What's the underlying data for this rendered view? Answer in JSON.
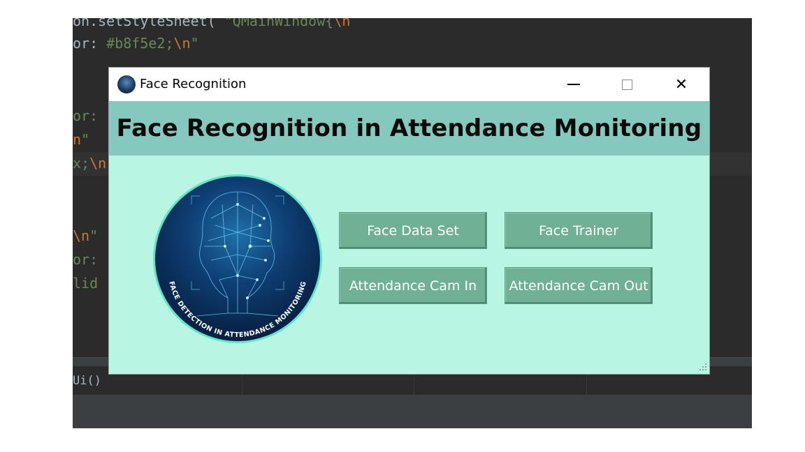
{
  "ide": {
    "code_lines": [
      {
        "a": "on.setStyleSheet(",
        "s": " \"QMainWindow{",
        "e": "\\n"
      },
      {
        "a": "or: ",
        "s": "#b8f5e2;",
        "e": "\\n",
        "t": "\""
      },
      {
        "a": "or:",
        "s": "",
        "e": "",
        "t": ""
      },
      {
        "a": "",
        "s": "n\"",
        "e": "",
        "t": ""
      },
      {
        "a": "x;",
        "s": "",
        "e": "\\n",
        "t": ""
      },
      {
        "a": "",
        "s": "",
        "e": "\\n",
        "t": "\""
      },
      {
        "a": "or:",
        "s": "",
        "e": "",
        "t": ""
      },
      {
        "a": "lid",
        "s": "",
        "e": "",
        "t": ""
      }
    ],
    "status_text": "Ui()"
  },
  "window": {
    "title": "Face Recognition",
    "minimize_label": "",
    "close_glyph": "✕",
    "header_title": "Face Recognition in Attendance Monitoring",
    "logo_caption": "FACE DETECTION IN ATTENDANCE MONITORING",
    "buttons": {
      "face_data_set": "Face Data Set",
      "face_trainer": "Face Trainer",
      "cam_in": "Attendance Cam In",
      "cam_out": "Attendance Cam Out"
    }
  },
  "colors": {
    "window_bg": "#b8f5e2",
    "header_bg": "#85c9be",
    "button_bg": "#70b196",
    "logo_ring": "#5fe6c8"
  },
  "icons": [
    "app-icon",
    "minimize-icon",
    "maximize-icon",
    "close-icon",
    "size-grip-icon"
  ]
}
